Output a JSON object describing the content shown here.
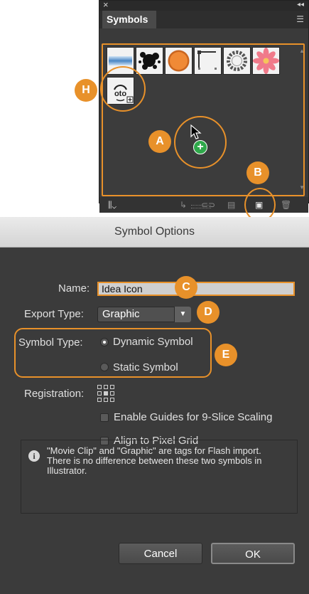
{
  "symbols_panel": {
    "close_glyph": "×",
    "collapse_glyph": "◂◂",
    "tab_label": "Symbols",
    "menu_glyph": "☰",
    "icons": {
      "library": "symbol-libraries-menu-icon",
      "place": "place-symbol-instance-icon",
      "break_link": "break-link-icon",
      "options": "symbol-options-icon",
      "new": "new-symbol-icon",
      "delete": "delete-symbol-icon"
    },
    "callouts": {
      "a": "A",
      "b": "B",
      "h": "H"
    },
    "idea_symbol_text": "oto"
  },
  "dialog": {
    "title": "Symbol Options",
    "name_label": "Name:",
    "name_value": "Idea Icon",
    "export_type_label": "Export Type:",
    "export_type_value": "Graphic",
    "symbol_type_label": "Symbol Type:",
    "dynamic_symbol_label": "Dynamic Symbol",
    "static_symbol_label": "Static Symbol",
    "registration_label": "Registration:",
    "enable_guides_label": "Enable Guides for 9-Slice Scaling",
    "align_pixel_label": "Align to Pixel Grid",
    "info_text": "\"Movie Clip\" and \"Graphic\" are tags for Flash import. There is no difference between these two symbols in Illustrator.",
    "cancel_label": "Cancel",
    "ok_label": "OK",
    "callouts": {
      "c": "C",
      "d": "D",
      "e": "E"
    }
  },
  "colors": {
    "accent": "#e8912a",
    "panel_bg": "#3a3a3a",
    "dialog_bg": "#3b3b3b"
  }
}
